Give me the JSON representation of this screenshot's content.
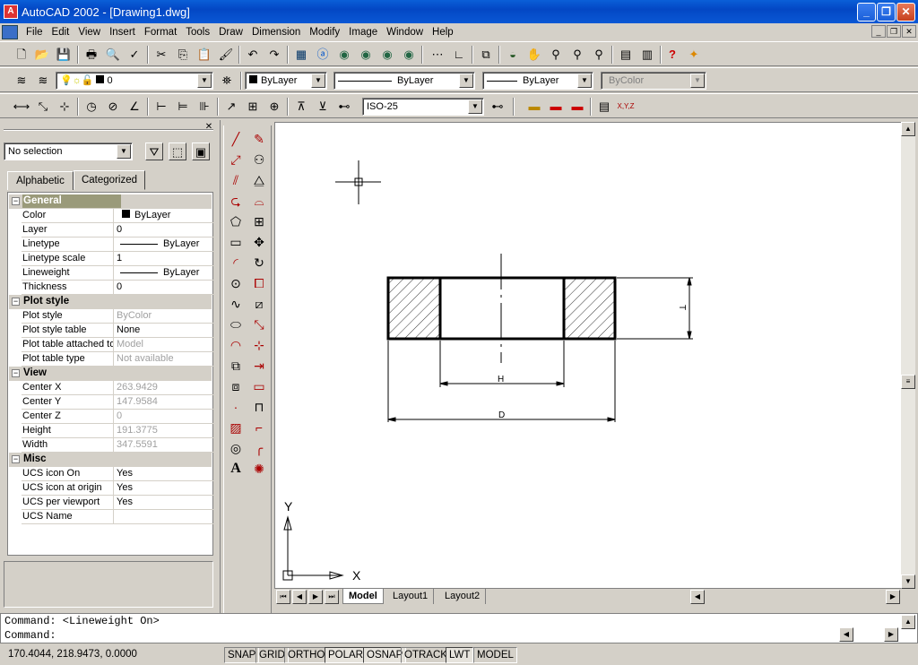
{
  "window": {
    "title": "AutoCAD 2002 - [Drawing1.dwg]",
    "app_icon": "A"
  },
  "menu": [
    "File",
    "Edit",
    "View",
    "Insert",
    "Format",
    "Tools",
    "Draw",
    "Dimension",
    "Modify",
    "Image",
    "Window",
    "Help"
  ],
  "standard_toolbar": [
    "new-icon",
    "open-icon",
    "save-icon",
    "print-icon",
    "preview-icon",
    "publish-icon",
    "cut-icon",
    "copy-icon",
    "paste-icon",
    "match-properties-icon",
    "undo-icon",
    "redo-icon",
    "design-center-icon",
    "hyperlink-icon",
    "snap-icon",
    "ucs-icon",
    "pan-icon",
    "zoom-icon",
    "help-icon"
  ],
  "layers": {
    "current_layer": "0",
    "color": "ByLayer",
    "linetype": "ByLayer",
    "lineweight": "ByLayer",
    "plotstyle": "ByColor"
  },
  "dimstyle": {
    "current": "ISO-25"
  },
  "properties": {
    "selection": "No selection",
    "tabs": [
      "Alphabetic",
      "Categorized"
    ],
    "categories": {
      "general": "General",
      "plot_style": "Plot style",
      "view": "View",
      "misc": "Misc"
    },
    "general": [
      {
        "key": "Color",
        "value": "ByLayer"
      },
      {
        "key": "Layer",
        "value": "0"
      },
      {
        "key": "Linetype",
        "value": "ByLayer"
      },
      {
        "key": "Linetype scale",
        "value": "1"
      },
      {
        "key": "Lineweight",
        "value": "ByLayer"
      },
      {
        "key": "Thickness",
        "value": "0"
      }
    ],
    "plot_style": [
      {
        "key": "Plot style",
        "value": "ByColor"
      },
      {
        "key": "Plot style table",
        "value": "None"
      },
      {
        "key": "Plot table attached to",
        "value": "Model"
      },
      {
        "key": "Plot table type",
        "value": "Not available"
      }
    ],
    "view": [
      {
        "key": "Center X",
        "value": "263.9429"
      },
      {
        "key": "Center Y",
        "value": "147.9584"
      },
      {
        "key": "Center Z",
        "value": "0"
      },
      {
        "key": "Height",
        "value": "191.3775"
      },
      {
        "key": "Width",
        "value": "347.5591"
      }
    ],
    "misc": [
      {
        "key": "UCS icon On",
        "value": "Yes"
      },
      {
        "key": "UCS icon at origin",
        "value": "Yes"
      },
      {
        "key": "UCS per viewport",
        "value": "Yes"
      },
      {
        "key": "UCS Name",
        "value": ""
      }
    ]
  },
  "drawing": {
    "dim_h": "H",
    "dim_d": "D",
    "dim_t": "T",
    "ucs_x": "X",
    "ucs_y": "Y"
  },
  "layout_tabs": [
    "Model",
    "Layout1",
    "Layout2"
  ],
  "command": {
    "line1": "Command:  <Lineweight On>",
    "line2": "Command:"
  },
  "status": {
    "coords": "170.4044, 218.9473, 0.0000",
    "toggles": [
      "SNAP",
      "GRID",
      "ORTHO",
      "POLAR",
      "OSNAP",
      "OTRACK",
      "LWT",
      "MODEL"
    ]
  }
}
